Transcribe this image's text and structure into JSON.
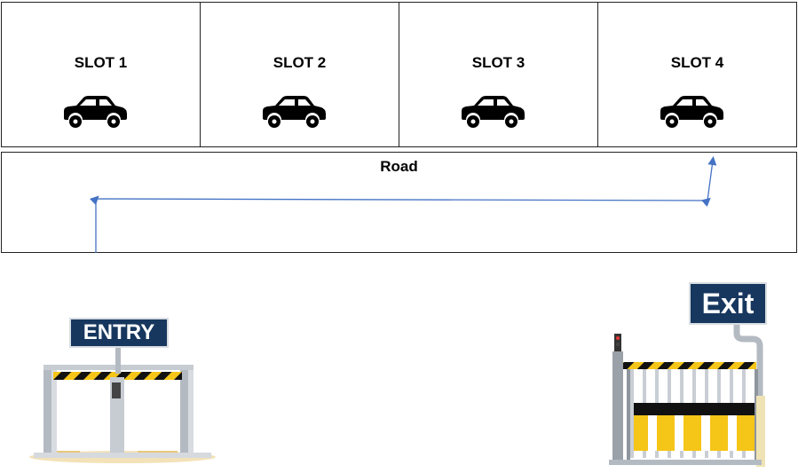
{
  "slots": [
    {
      "label": "SLOT 1",
      "icon": "car-icon"
    },
    {
      "label": "SLOT 2",
      "icon": "car-icon"
    },
    {
      "label": "SLOT 3",
      "icon": "car-icon"
    },
    {
      "label": "SLOT 4",
      "icon": "car-icon"
    }
  ],
  "road": {
    "label": "Road"
  },
  "route": {
    "from": "entry",
    "to": "SLOT 4",
    "color": "#4472c4"
  },
  "entry": {
    "label": "ENTRY",
    "icon": "entry-barrier-gate-icon"
  },
  "exit": {
    "label": "Exit",
    "icon": "exit-barrier-gate-icon"
  },
  "colors": {
    "sign": "#17375e",
    "hazard_yellow": "#f5c518",
    "hazard_black": "#111111",
    "steel": "#b4bac2"
  }
}
